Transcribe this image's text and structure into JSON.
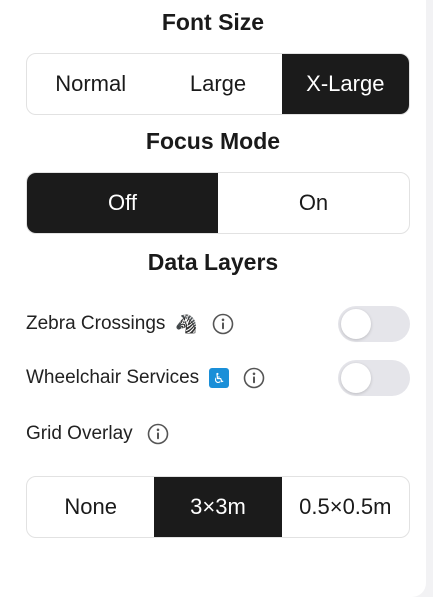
{
  "font_size": {
    "title": "Font Size",
    "options": [
      "Normal",
      "Large",
      "X-Large"
    ],
    "selected": "X-Large"
  },
  "focus_mode": {
    "title": "Focus Mode",
    "options": [
      "Off",
      "On"
    ],
    "selected": "Off"
  },
  "data_layers": {
    "title": "Data Layers",
    "zebra": {
      "label": "Zebra Crossings",
      "emoji": "🦓",
      "enabled": false
    },
    "wheelchair": {
      "label": "Wheelchair Services",
      "emoji": "♿",
      "enabled": false
    },
    "grid": {
      "label": "Grid Overlay",
      "options": [
        "None",
        "3×3m",
        "0.5×0.5m"
      ],
      "selected": "3×3m"
    }
  },
  "icons": {
    "info": "info-circle-icon",
    "zebra": "zebra-icon",
    "wheelchair": "wheelchair-icon"
  },
  "colors": {
    "active_segment": "#1b1b1b",
    "toggle_off": "#e5e5ea",
    "wheelchair_badge": "#1a8fd8"
  }
}
